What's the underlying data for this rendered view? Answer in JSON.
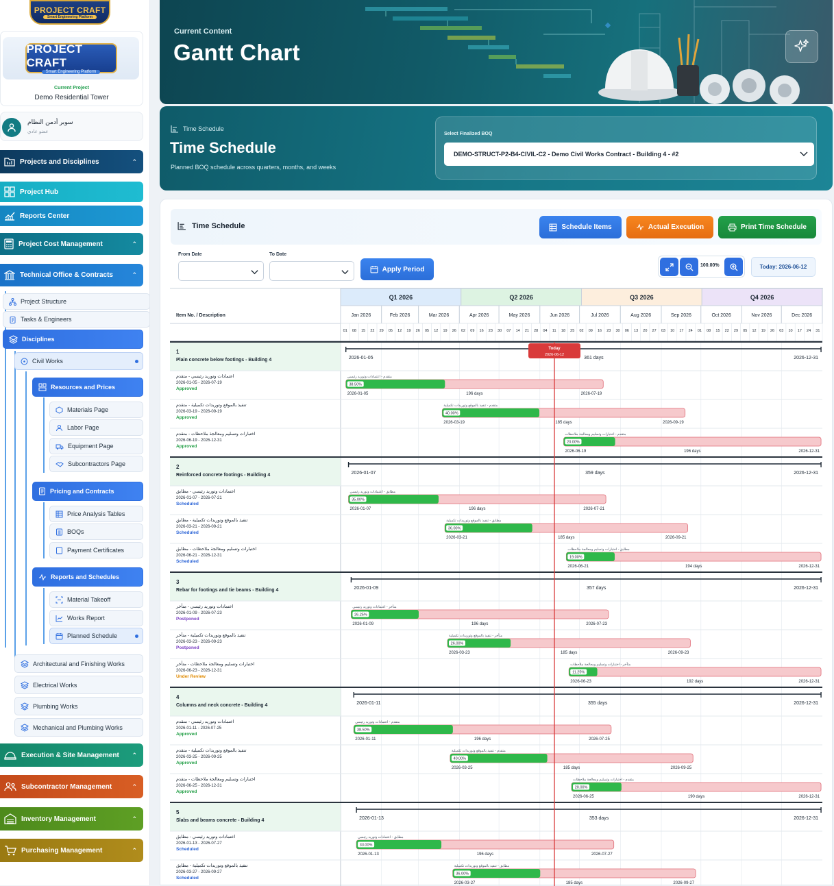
{
  "brand": {
    "top_name": "PROJECT CRAFT",
    "top_tagline": "Smart Engineering Platform",
    "main_name": "PROJECT CRAFT",
    "main_tagline": "Smart Engineering Platform"
  },
  "current_project": {
    "label": "Current Project",
    "name": "Demo Residential Tower"
  },
  "user": {
    "name": "سوبر أدمن النظام",
    "role": "عضو عادي"
  },
  "nav": {
    "projects_disciplines": "Projects and Disciplines",
    "project_hub": "Project Hub",
    "reports_center": "Reports Center",
    "project_cost": "Project Cost Management",
    "tech_office": "Technical Office & Contracts",
    "project_structure": "Project Structure",
    "tasks_engineers": "Tasks & Engineers",
    "disciplines": "Disciplines",
    "civil_works": "Civil Works",
    "resources_prices": "Resources and Prices",
    "materials_page": "Materials Page",
    "labor_page": "Labor Page",
    "equipment_page": "Equipment Page",
    "subcontractors_page": "Subcontractors Page",
    "pricing_contracts": "Pricing and Contracts",
    "price_analysis": "Price Analysis Tables",
    "boqs": "BOQs",
    "payment_certificates": "Payment Certificates",
    "reports_schedules": "Reports and Schedules",
    "material_takeoff": "Material Takeoff",
    "works_report": "Works Report",
    "planned_schedule": "Planned Schedule",
    "arch_finishing": "Architectural and Finishing Works",
    "electrical": "Electrical Works",
    "plumbing": "Plumbing Works",
    "mechanical_plumbing": "Mechanical and Plumbing Works",
    "execution_site": "Execution & Site Management",
    "subcontractor_mgmt": "Subcontractor Management",
    "inventory": "Inventory Management",
    "purchasing": "Purchasing Management"
  },
  "hero": {
    "kicker": "Current Content",
    "title": "Gantt Chart"
  },
  "schedule_card": {
    "kicker": "Time Schedule",
    "title": "Time Schedule",
    "description": "Planned BOQ schedule across quarters, months, and weeks",
    "boq_label": "Select Finalized BOQ",
    "boq_value": "DEMO-STRUCT-P2-B4-CIVIL-C2 - Demo Civil Works Contract - Building 4 - #2"
  },
  "panel": {
    "title": "Time Schedule",
    "btn_items": "Schedule Items",
    "btn_actual": "Actual Execution",
    "btn_print": "Print Time Schedule",
    "from_label": "From Date",
    "to_label": "To Date",
    "apply": "Apply Period",
    "zoom": "100.00%",
    "today": "Today: 2026-06-12"
  },
  "colors": {
    "approved": "#1f9d43",
    "scheduled": "#2a63d6",
    "postponed": "#7b3fc4",
    "under_review": "#e08a00",
    "bar_fill": "#2fb84a",
    "bar_plan": "#f6c9cc",
    "today": "#d93a3a"
  },
  "chart_data": {
    "type": "gantt",
    "header_col": "Item No. / Description",
    "today_label": "Today",
    "today_date": "2026-06-12",
    "quarters": [
      "Q1 2026",
      "Q2 2026",
      "Q3 2026",
      "Q4 2026"
    ],
    "months": [
      "Jan 2026",
      "Feb 2026",
      "Mar 2026",
      "Apr 2026",
      "May 2026",
      "Jun 2026",
      "Jul 2026",
      "Aug 2026",
      "Sep 2026",
      "Oct 2026",
      "Nov 2026",
      "Dec 2026"
    ],
    "weeks": [
      "01",
      "08",
      "15",
      "22",
      "29",
      "05",
      "12",
      "19",
      "26",
      "05",
      "12",
      "19",
      "26",
      "02",
      "09",
      "16",
      "23",
      "30",
      "07",
      "14",
      "21",
      "28",
      "04",
      "11",
      "18",
      "25",
      "02",
      "09",
      "16",
      "23",
      "30",
      "06",
      "13",
      "20",
      "27",
      "03",
      "10",
      "17",
      "24",
      "01",
      "08",
      "15",
      "22",
      "29",
      "05",
      "12",
      "19",
      "26",
      "03",
      "10",
      "17",
      "24",
      "31"
    ],
    "items": [
      {
        "no": "1",
        "title": "Plain concrete below footings - Building 4",
        "start": "2026-01-05",
        "end": "2026-12-31",
        "days": "361 days",
        "tasks": [
          {
            "name": "اعتمادات وتوريد رئيسي - متقدم",
            "label": "متقدم - اعتمادات وتوريد رئيسي",
            "dates": "2026-01-05 - 2026-07-19",
            "start": "2026-01-05",
            "end": "2026-07-19",
            "days": "196 days",
            "pct": "38.50%",
            "p": 0.385,
            "status": "Approved"
          },
          {
            "name": "تنفيذ بالموقع وتوريدات تكميلية - متقدم",
            "label": "متقدم - تنفيذ بالموقع وتوريدات تكميلية",
            "dates": "2026-03-19 - 2026-09-19",
            "start": "2026-03-19",
            "end": "2026-09-19",
            "days": "185 days",
            "pct": "40.00%",
            "p": 0.4,
            "status": "Approved"
          },
          {
            "name": "اختبارات وتسليم ومعالجة ملاحظات - متقدم",
            "label": "متقدم - اختبارات وتسليم ومعالجة ملاحظات",
            "dates": "2026-06-19 - 2026-12-31",
            "start": "2026-06-19",
            "end": "2026-12-31",
            "days": "196 days",
            "pct": "20.00%",
            "p": 0.2,
            "status": "Approved"
          }
        ]
      },
      {
        "no": "2",
        "title": "Reinforced concrete footings - Building 4",
        "start": "2026-01-07",
        "end": "2026-12-31",
        "days": "359 days",
        "tasks": [
          {
            "name": "اعتمادات وتوريد رئيسي - مطابق",
            "label": "مطابق - اعتمادات وتوريد رئيسي",
            "dates": "2026-01-07 - 2026-07-21",
            "start": "2026-01-07",
            "end": "2026-07-21",
            "days": "196 days",
            "pct": "35.00%",
            "p": 0.35,
            "status": "Scheduled"
          },
          {
            "name": "تنفيذ بالموقع وتوريدات تكميلية - مطابق",
            "label": "مطابق - تنفيذ بالموقع وتوريدات تكميلية",
            "dates": "2026-03-21 - 2026-09-21",
            "start": "2026-03-21",
            "end": "2026-09-21",
            "days": "185 days",
            "pct": "36.00%",
            "p": 0.36,
            "status": "Scheduled"
          },
          {
            "name": "اختبارات وتسليم ومعالجة ملاحظات - مطابق",
            "label": "مطابق - اختبارات وتسليم ومعالجة ملاحظات",
            "dates": "2026-06-21 - 2026-12-31",
            "start": "2026-06-21",
            "end": "2026-12-31",
            "days": "194 days",
            "pct": "19.00%",
            "p": 0.19,
            "status": "Scheduled"
          }
        ]
      },
      {
        "no": "3",
        "title": "Rebar for footings and tie beams - Building 4",
        "start": "2026-01-09",
        "end": "2026-12-31",
        "days": "357 days",
        "tasks": [
          {
            "name": "اعتمادات وتوريد رئيسي - متأخر",
            "label": "متأخر - اعتمادات وتوريد رئيسي",
            "dates": "2026-01-09 - 2026-07-23",
            "start": "2026-01-09",
            "end": "2026-07-23",
            "days": "196 days",
            "pct": "26.25%",
            "p": 0.2625,
            "status": "Postponed"
          },
          {
            "name": "تنفيذ بالموقع وتوريدات تكميلية - متأخر",
            "label": "متأخر - تنفيذ بالموقع وتوريدات تكميلية",
            "dates": "2026-03-23 - 2026-09-23",
            "start": "2026-03-23",
            "end": "2026-09-23",
            "days": "185 days",
            "pct": "26.00%",
            "p": 0.26,
            "status": "Postponed"
          },
          {
            "name": "اختبارات وتسليم ومعالجة ملاحظات - متأخر",
            "label": "متأخر - اختبارات وتسليم ومعالجة ملاحظات",
            "dates": "2026-06-23 - 2026-12-31",
            "start": "2026-06-23",
            "end": "2026-12-31",
            "days": "192 days",
            "pct": "11.25%",
            "p": 0.1125,
            "status": "Under Review"
          }
        ]
      },
      {
        "no": "4",
        "title": "Columns and neck concrete - Building 4",
        "start": "2026-01-11",
        "end": "2026-12-31",
        "days": "355 days",
        "tasks": [
          {
            "name": "اعتمادات وتوريد رئيسي - متقدم",
            "label": "متقدم - اعتمادات وتوريد رئيسي",
            "dates": "2026-01-11 - 2026-07-25",
            "start": "2026-01-11",
            "end": "2026-07-25",
            "days": "196 days",
            "pct": "38.50%",
            "p": 0.385,
            "status": "Approved"
          },
          {
            "name": "تنفيذ بالموقع وتوريدات تكميلية - متقدم",
            "label": "متقدم - تنفيذ بالموقع وتوريدات تكميلية",
            "dates": "2026-03-25 - 2026-09-25",
            "start": "2026-03-25",
            "end": "2026-09-25",
            "days": "185 days",
            "pct": "40.00%",
            "p": 0.4,
            "status": "Approved"
          },
          {
            "name": "اختبارات وتسليم ومعالجة ملاحظات - متقدم",
            "label": "متقدم - اختبارات وتسليم ومعالجة ملاحظات",
            "dates": "2026-06-25 - 2026-12-31",
            "start": "2026-06-25",
            "end": "2026-12-31",
            "days": "190 days",
            "pct": "20.00%",
            "p": 0.2,
            "status": "Approved"
          }
        ]
      },
      {
        "no": "5",
        "title": "Slabs and beams concrete - Building 4",
        "start": "2026-01-13",
        "end": "2026-12-31",
        "days": "353 days",
        "tasks": [
          {
            "name": "اعتمادات وتوريد رئيسي - مطابق",
            "label": "مطابق - اعتمادات وتوريد رئيسي",
            "dates": "2026-01-13 - 2026-07-27",
            "start": "2026-01-13",
            "end": "2026-07-27",
            "days": "196 days",
            "pct": "33.00%",
            "p": 0.33,
            "status": "Scheduled"
          },
          {
            "name": "تنفيذ بالموقع وتوريدات تكميلية - مطابق",
            "label": "مطابق - تنفيذ بالموقع وتوريدات تكميلية",
            "dates": "2026-03-27 - 2026-09-27",
            "start": "2026-03-27",
            "end": "2026-09-27",
            "days": "185 days",
            "pct": "36.00%",
            "p": 0.36,
            "status": "Scheduled"
          }
        ]
      }
    ]
  }
}
